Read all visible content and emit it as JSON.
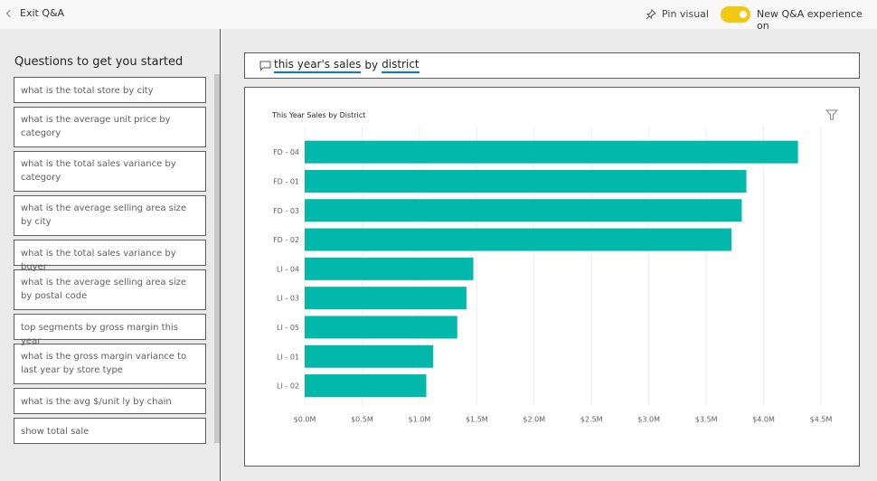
{
  "topbar": {
    "exit_label": "Exit Q&A",
    "pin_label": "Pin visual",
    "toggle_label": "New Q&A experience on",
    "toggle_on": true,
    "toggle_color": "#f2c811"
  },
  "sidebar": {
    "title": "Questions to get you started",
    "questions": [
      "what is the total store by city",
      "what is the average unit price by category",
      "what is the total sales variance by category",
      "what is the average selling area size by city",
      "what is the total sales variance by buyer",
      "what is the average selling area size by postal code",
      "top segments by gross margin this year",
      "what is the gross margin variance to last year by store type",
      "what is the avg $/unit ly by chain",
      "show total sale"
    ]
  },
  "qa": {
    "query_parts": [
      "this year's sales",
      "by",
      "district"
    ],
    "underline_color": "#0078d4"
  },
  "chart_data": {
    "type": "bar",
    "orientation": "horizontal",
    "title": "This Year Sales by District",
    "xlabel": "",
    "ylabel": "",
    "categories": [
      "FD - 04",
      "FD - 01",
      "FD - 03",
      "FD - 02",
      "LI - 04",
      "LI - 03",
      "LI - 05",
      "LI - 01",
      "LI - 02"
    ],
    "values": [
      4.3,
      3.85,
      3.81,
      3.72,
      1.47,
      1.41,
      1.33,
      1.12,
      1.06
    ],
    "units": "$M",
    "xlim": [
      0,
      4.5
    ],
    "xticks": [
      "$0.0M",
      "$0.5M",
      "$1.0M",
      "$1.5M",
      "$2.0M",
      "$2.5M",
      "$3.0M",
      "$3.5M",
      "$4.0M",
      "$4.5M"
    ],
    "grid": true,
    "bar_color": "#01b8aa"
  }
}
